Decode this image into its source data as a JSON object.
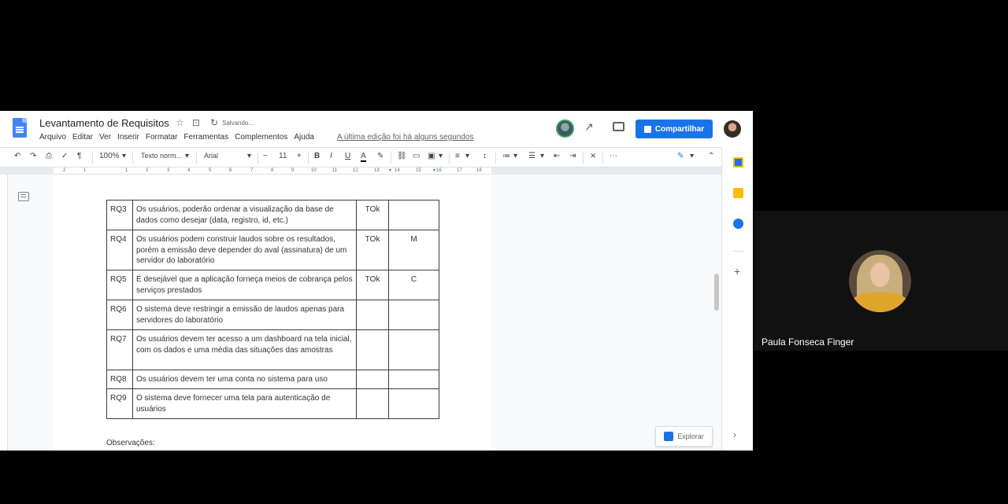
{
  "doc": {
    "title": "Levantamento de Requisitos",
    "saving": "Salvando...",
    "last_edit": "A última edição foi há alguns segundos",
    "menu": [
      "Arquivo",
      "Editar",
      "Ver",
      "Inserir",
      "Formatar",
      "Ferramentas",
      "Complementos",
      "Ajuda"
    ],
    "share_label": "Compartilhar"
  },
  "toolbar": {
    "zoom": "100%",
    "style": "Texto norm...",
    "font": "Arial",
    "font_size": "11"
  },
  "ruler": {
    "numbers": [
      "2",
      "1",
      "1",
      "2",
      "3",
      "4",
      "5",
      "6",
      "7",
      "8",
      "9",
      "10",
      "11",
      "12",
      "13",
      "14",
      "15",
      "16",
      "17",
      "18"
    ]
  },
  "table": {
    "rows": [
      {
        "id": "RQ3",
        "desc": "Os usuários, poderão ordenar a visualização da base de dados como desejar (data, registro, id,  etc.)",
        "c3": "TOk",
        "c4": ""
      },
      {
        "id": "RQ4",
        "desc": "Os usuários podem construir laudos sobre os resultados, porém a emissão deve depender do aval (assinatura) de um servidor do laboratório",
        "c3": "TOk",
        "c4": "M"
      },
      {
        "id": "RQ5",
        "desc": "É desejável que a aplicação forneça meios de cobrança pelos serviços prestados",
        "c3": "TOk",
        "c4": "C"
      },
      {
        "id": "RQ6",
        "desc": "O sistema deve restringir a emissão de laudos apenas para servidores do laboratório",
        "c3": "",
        "c4": ""
      },
      {
        "id": "RQ7",
        "desc": "Os usuários devem ter acesso a um dashboard na tela inicial, com os dados e uma média das situações das amostras",
        "c3": "",
        "c4": ""
      },
      {
        "id": "RQ8",
        "desc": "Os usuários devem ter uma conta no sistema para uso",
        "c3": "",
        "c4": ""
      },
      {
        "id": "RQ9",
        "desc": "O sistema deve fornecer uma tela para autenticação de usuários",
        "c3": "",
        "c4": ""
      }
    ]
  },
  "observations_label": "Observações:",
  "explore_label": "Explorar",
  "participant": {
    "name": "Paula Fonseca Finger"
  },
  "colors": {
    "accent": "#1a73e8",
    "docs_blue": "#4285f4"
  }
}
